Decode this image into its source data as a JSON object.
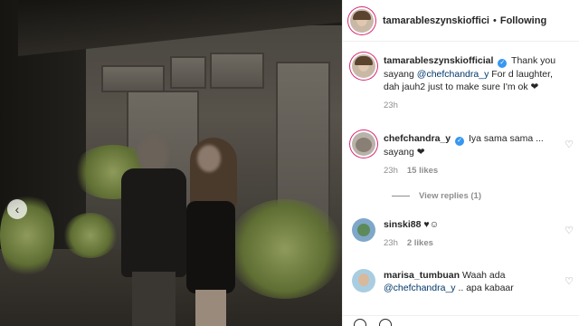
{
  "post": {
    "author": "tamarableszynskiofficial",
    "author_header": "tamarableszynskioffici",
    "follow_state": "Following",
    "dot": "•"
  },
  "comments": [
    {
      "user": "tamarableszynskiofficial",
      "verified": true,
      "text_pre": "Thank you sayang ",
      "mention": "@chefchandra_y",
      "text_post": " For d laughter, dah jauh2 just to make sure I'm ok ❤",
      "time": "23h",
      "likes": "",
      "has_heart": false
    },
    {
      "user": "chefchandra_y",
      "verified": true,
      "text_pre": "Iya sama sama ... sayang ❤",
      "mention": "",
      "text_post": "",
      "time": "23h",
      "likes": "15 likes",
      "has_heart": true
    },
    {
      "user": "sinski88",
      "verified": false,
      "text_pre": "♥☺",
      "mention": "",
      "text_post": "",
      "time": "23h",
      "likes": "2 likes",
      "has_heart": true
    },
    {
      "user": "marisa_tumbuan",
      "verified": false,
      "text_pre": "Waah ada ",
      "mention": "@chefchandra_y",
      "text_post": " .. apa kabaar",
      "time": "",
      "likes": "",
      "has_heart": true
    }
  ],
  "view_replies": "View replies (1)",
  "icons": {
    "carousel_prev": "chevron-left-icon",
    "verified": "verified-badge-icon",
    "heart": "heart-outline-icon"
  },
  "colors": {
    "verified_blue": "#3897f0",
    "mention": "#00376b",
    "meta_gray": "#8e8e8e",
    "story_ring": "#d62976"
  }
}
